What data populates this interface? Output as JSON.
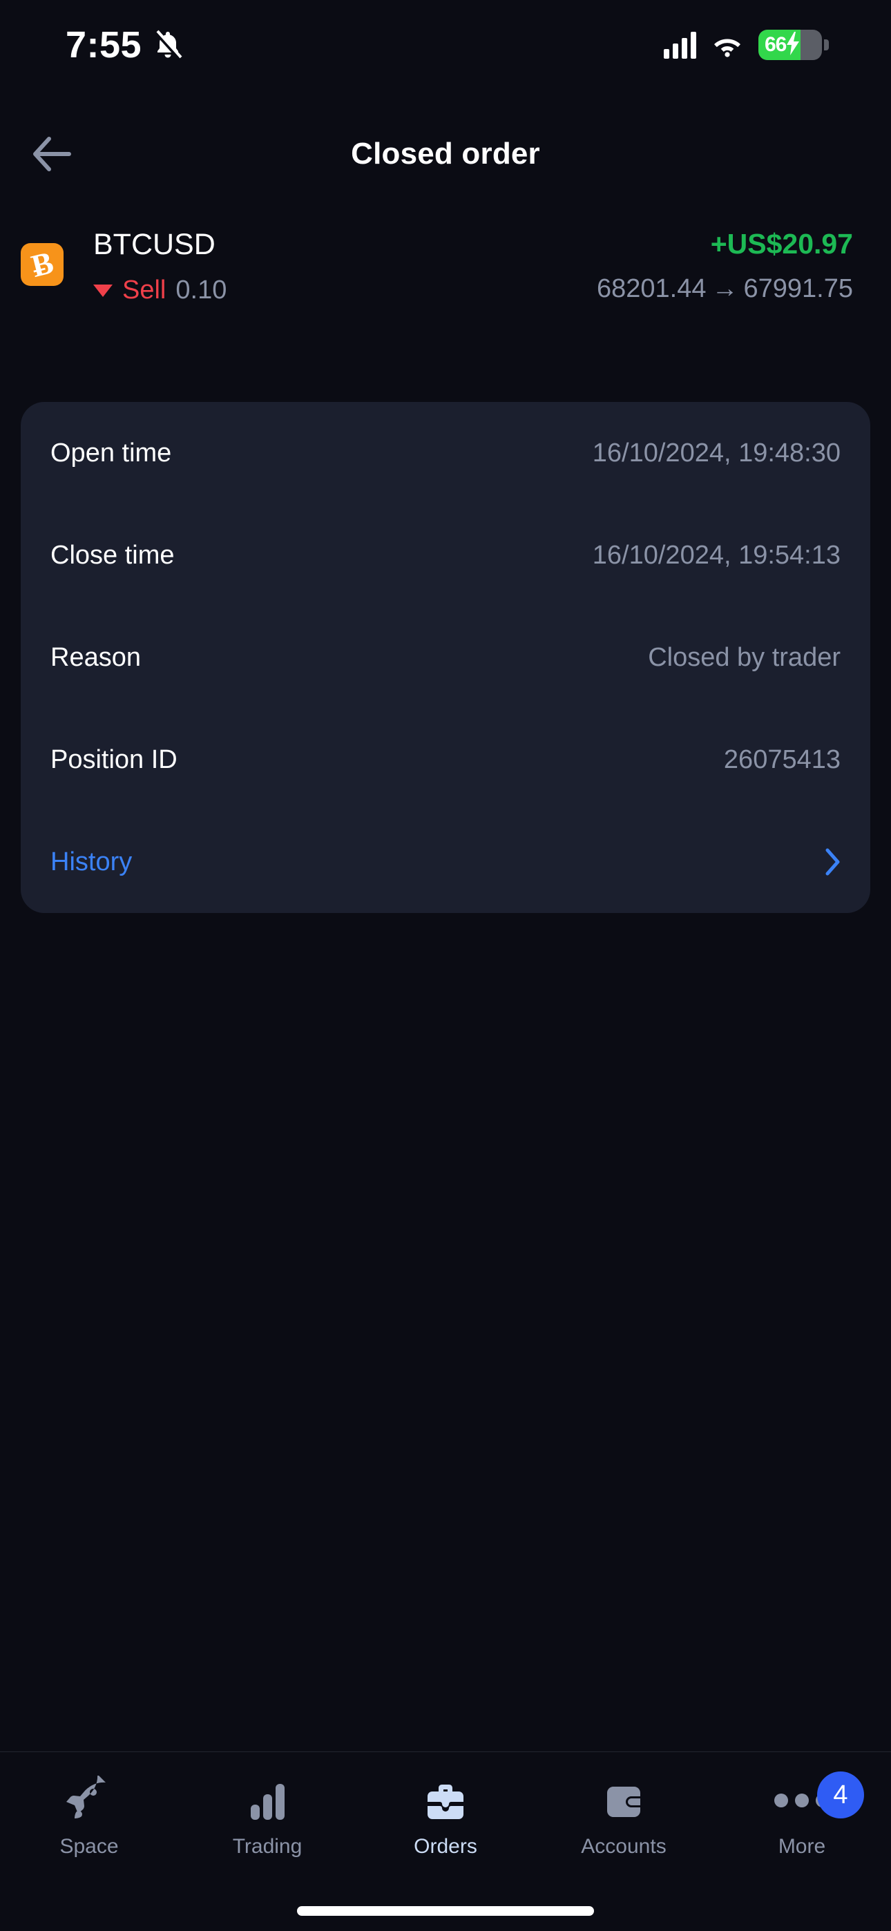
{
  "status_bar": {
    "time": "7:55",
    "bell_icon": "bell-muted-icon",
    "signal_icon": "cellular-signal-icon",
    "wifi_icon": "wifi-icon",
    "battery_percent": "66",
    "battery_level": 66,
    "battery_charging": true,
    "battery_color": "#32d74b"
  },
  "header": {
    "back_icon": "back-arrow-icon",
    "title": "Closed order"
  },
  "order": {
    "icon_name": "bitcoin-icon",
    "icon_glyph": "Ƀ",
    "icon_bg": "#f7931a",
    "symbol": "BTCUSD",
    "pnl": "+US$20.97",
    "pnl_color": "#1db954",
    "direction_icon": "triangle-down-icon",
    "direction": "Sell",
    "direction_color": "#f0404a",
    "volume": "0.10",
    "open_price": "68201.44",
    "price_arrow": "→",
    "close_price": "67991.75"
  },
  "details": {
    "rows": [
      {
        "label": "Open time",
        "value": "16/10/2024, 19:48:30"
      },
      {
        "label": "Close time",
        "value": "16/10/2024, 19:54:13"
      },
      {
        "label": "Reason",
        "value": "Closed by trader"
      },
      {
        "label": "Position ID",
        "value": "26075413"
      }
    ],
    "history": {
      "label": "History",
      "chevron_icon": "chevron-right-icon",
      "color": "#3b82f6"
    }
  },
  "tabbar": {
    "active_color": "#ccdcf5",
    "inactive_color": "#8b93a7",
    "badge_color": "#2f5cf4",
    "items": [
      {
        "label": "Space",
        "icon": "rocket-icon",
        "active": false
      },
      {
        "label": "Trading",
        "icon": "bar-chart-icon",
        "active": false
      },
      {
        "label": "Orders",
        "icon": "briefcase-icon",
        "active": true
      },
      {
        "label": "Accounts",
        "icon": "wallet-icon",
        "active": false
      },
      {
        "label": "More",
        "icon": "ellipsis-icon",
        "active": false,
        "badge": "4"
      }
    ]
  }
}
